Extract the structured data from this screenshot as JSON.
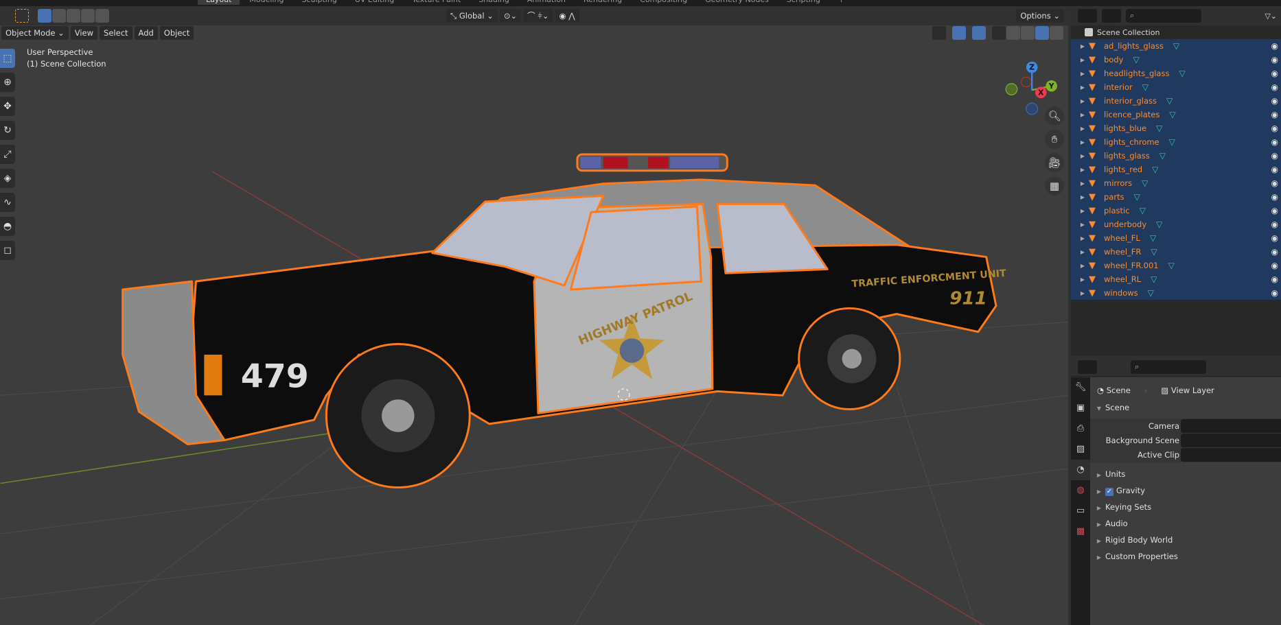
{
  "workspace_tabs": [
    "Layout",
    "Modeling",
    "Sculpting",
    "UV Editing",
    "Texture Paint",
    "Shading",
    "Animation",
    "Rendering",
    "Compositing",
    "Geometry Nodes",
    "Scripting",
    "+"
  ],
  "tool_header": {
    "orientation": "Global",
    "options": "Options"
  },
  "viewport_header": {
    "mode": "Object Mode",
    "menus": [
      "View",
      "Select",
      "Add",
      "Object"
    ]
  },
  "overlay_text": {
    "view": "User Perspective",
    "collection": "(1) Scene Collection"
  },
  "gizmo": {
    "z": "Z",
    "y": "Y",
    "x": "X"
  },
  "car_decals": {
    "number": "479",
    "door": "HIGHWAY PATROL",
    "rear": "TRAFFIC ENFORCMENT UNIT",
    "rear_number": "911"
  },
  "outliner": {
    "root": "Scene Collection",
    "items": [
      "ad_lights_glass",
      "body",
      "headlights_glass",
      "interior",
      "interior_glass",
      "licence_plates",
      "lights_blue",
      "lights_chrome",
      "lights_glass",
      "lights_red",
      "mirrors",
      "parts",
      "plastic",
      "underbody",
      "wheel_FL",
      "wheel_FR",
      "wheel_FR.001",
      "wheel_RL",
      "windows"
    ]
  },
  "properties": {
    "breadcrumb": [
      "Scene",
      "View Layer"
    ],
    "section": "Scene",
    "fields": [
      {
        "label": "Camera",
        "value": ""
      },
      {
        "label": "Background Scene",
        "value": ""
      },
      {
        "label": "Active Clip",
        "value": ""
      }
    ],
    "panels": [
      {
        "label": "Units"
      },
      {
        "label": "Gravity",
        "checked": true
      },
      {
        "label": "Keying Sets"
      },
      {
        "label": "Audio"
      },
      {
        "label": "Rigid Body World"
      },
      {
        "label": "Custom Properties"
      }
    ]
  },
  "colors": {
    "selection": "#ff7a1a",
    "accent": "#4772b3",
    "outliner_selected": "#1f3a5e"
  }
}
